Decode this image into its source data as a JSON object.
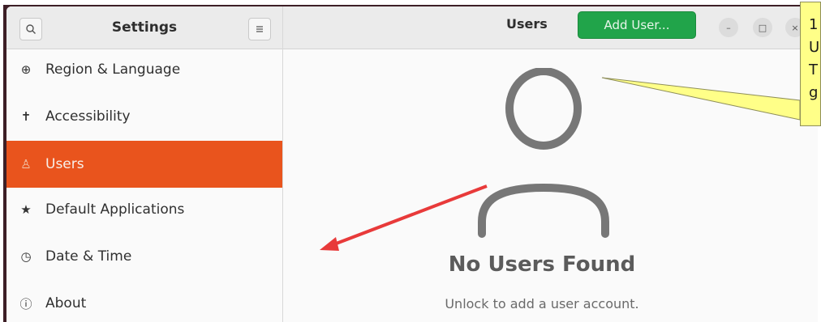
{
  "sidebar": {
    "title": "Settings",
    "search_icon": "search-icon",
    "menu_icon": "hamburger-menu-icon",
    "items": [
      {
        "label": "Region & Language",
        "icon": "globe-icon",
        "glyph": "⊕"
      },
      {
        "label": "Accessibility",
        "icon": "accessibility-icon",
        "glyph": "✝"
      },
      {
        "label": "Users",
        "icon": "user-icon",
        "glyph": "♙",
        "active": true
      },
      {
        "label": "Default Applications",
        "icon": "star-icon",
        "glyph": "★"
      },
      {
        "label": "Date & Time",
        "icon": "clock-icon",
        "glyph": "◷"
      },
      {
        "label": "About",
        "icon": "info-icon",
        "glyph": "ⓘ"
      }
    ]
  },
  "header": {
    "title": "Users",
    "add_user_label": "Add User...",
    "minimize_glyph": "–",
    "maximize_glyph": "□",
    "close_glyph": "×"
  },
  "main": {
    "empty_title": "No Users Found",
    "empty_subtitle": "Unlock to add a user account.",
    "placeholder_icon": "user-placeholder-icon"
  },
  "annotation": {
    "callout_lines": [
      "1",
      "U",
      "T",
      "g"
    ],
    "arrow_color": "#e83a3a",
    "callout_color": "#ffff88"
  },
  "colors": {
    "accent": "#e9541d",
    "add_button": "#21a44a"
  }
}
